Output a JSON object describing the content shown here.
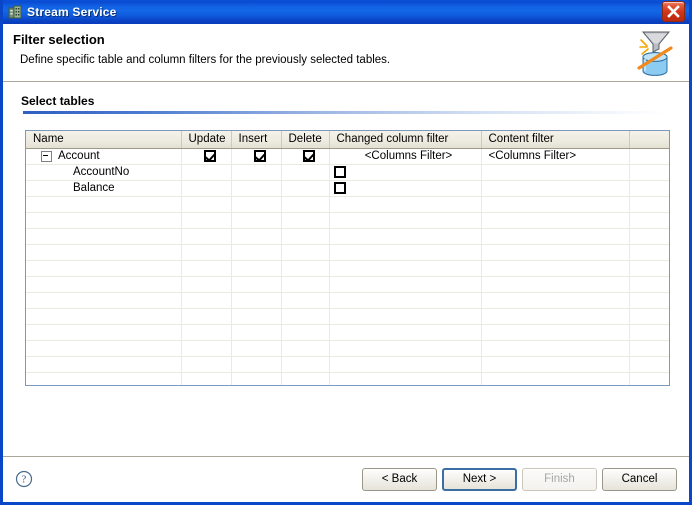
{
  "window": {
    "title": "Stream Service",
    "icon": "server-app-icon",
    "close_label": "Close",
    "accent_color": "#0a46c8",
    "titlebar_color": "#1060e2"
  },
  "banner": {
    "title": "Filter selection",
    "description": "Define specific table and column filters for the previously selected tables.",
    "icon": "filter-funnel-database-icon"
  },
  "section": {
    "title": "Select tables"
  },
  "table": {
    "columns": [
      {
        "key": "name",
        "label": "Name"
      },
      {
        "key": "update",
        "label": "Update"
      },
      {
        "key": "insert",
        "label": "Insert"
      },
      {
        "key": "delete",
        "label": "Delete"
      },
      {
        "key": "changed_column_filter",
        "label": "Changed column filter"
      },
      {
        "key": "content_filter",
        "label": "Content filter"
      },
      {
        "key": "spacer",
        "label": ""
      }
    ],
    "rows": [
      {
        "name": "Account",
        "type": "table",
        "expanded": true,
        "update": "checked",
        "insert": "checked",
        "delete": "checked",
        "changed_column_filter": "<Columns Filter>",
        "content_filter": "<Columns Filter>"
      },
      {
        "name": "AccountNo",
        "type": "column",
        "update": "",
        "insert": "",
        "delete": "",
        "changed_column_filter": "unchecked",
        "content_filter": ""
      },
      {
        "name": "Balance",
        "type": "column",
        "update": "",
        "insert": "",
        "delete": "",
        "changed_column_filter": "unchecked",
        "content_filter": ""
      }
    ],
    "empty_row_count": 11
  },
  "footer": {
    "help_icon": "help-question-icon",
    "buttons": [
      {
        "key": "back",
        "label": "< Back",
        "state": "enabled"
      },
      {
        "key": "next",
        "label": "Next >",
        "state": "default"
      },
      {
        "key": "finish",
        "label": "Finish",
        "state": "disabled"
      },
      {
        "key": "cancel",
        "label": "Cancel",
        "state": "enabled"
      }
    ]
  }
}
